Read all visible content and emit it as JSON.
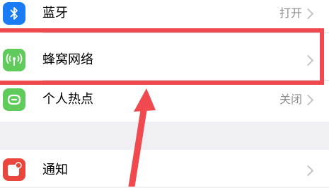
{
  "settings": {
    "rows": [
      {
        "label": "蓝牙",
        "value": "打开",
        "icon": "bluetooth-icon",
        "color": "#1a7cf5"
      },
      {
        "label": "蜂窝网络",
        "value": "",
        "icon": "cellular-antenna-icon",
        "color": "#5ecb5a"
      },
      {
        "label": "个人热点",
        "value": "关闭",
        "icon": "hotspot-link-icon",
        "color": "#5ecb5a"
      },
      {
        "label": "通知",
        "value": "",
        "icon": "notification-icon",
        "color": "#e9473e"
      }
    ]
  },
  "annotation": {
    "highlight_color": "#f0494f",
    "arrow_color": "#f0494f"
  }
}
